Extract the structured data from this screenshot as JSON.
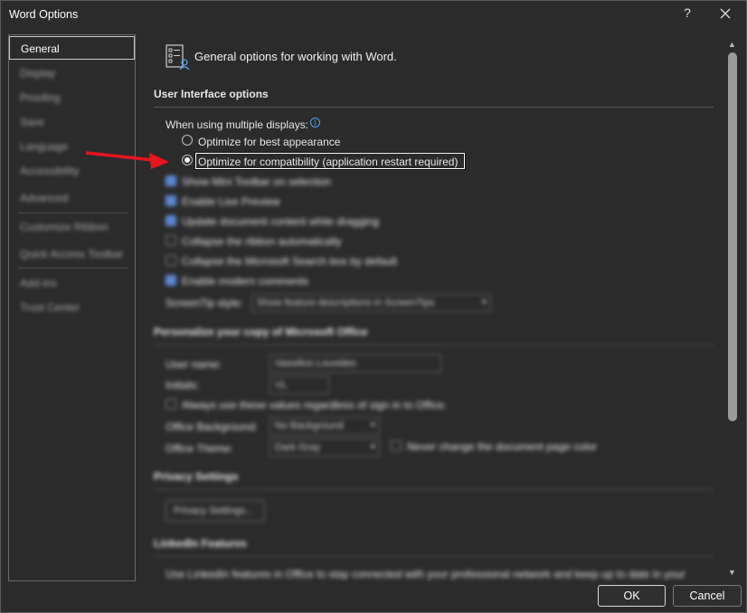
{
  "window": {
    "title": "Word Options",
    "help": "?"
  },
  "sidebar": {
    "items": [
      {
        "label": "General"
      },
      {
        "label": "Display"
      },
      {
        "label": "Proofing"
      },
      {
        "label": "Save"
      },
      {
        "label": "Language"
      },
      {
        "label": "Accessibility"
      },
      {
        "label": "Advanced"
      },
      {
        "label": "Customize Ribbon"
      },
      {
        "label": "Quick Access Toolbar"
      },
      {
        "label": "Add-ins"
      },
      {
        "label": "Trust Center"
      }
    ]
  },
  "main": {
    "header": "General options for working with Word.",
    "ui_section": {
      "title": "User Interface options",
      "multi_display_label": "When using multiple displays:",
      "radio_best": "Optimize for best appearance",
      "radio_compat": "Optimize for compatibility (application restart required)",
      "show_mini_toolbar": "Show Mini Toolbar on selection",
      "enable_live_preview": "Enable Live Preview",
      "update_content_dragging": "Update document content while dragging",
      "collapse_ribbon": "Collapse the ribbon automatically",
      "collapse_search": "Collapse the Microsoft Search box by default",
      "enable_modern_comments": "Enable modern comments",
      "screentip_label": "ScreenTip style:",
      "screentip_value": "Show feature descriptions in ScreenTips"
    },
    "personalize_section": {
      "title": "Personalize your copy of Microsoft Office",
      "username_label": "User name:",
      "username_value": "Vassilios Louvides",
      "initials_label": "Initials:",
      "initials_value": "VL",
      "always_use_label": "Always use these values regardless of sign in to Office.",
      "background_label": "Office Background:",
      "background_value": "No Background",
      "theme_label": "Office Theme:",
      "theme_value": "Dark Gray",
      "never_change_label": "Never change the document page color"
    },
    "privacy_section": {
      "title": "Privacy Settings",
      "button": "Privacy Settings..."
    },
    "linkedin_section": {
      "title": "LinkedIn Features",
      "text": "Use LinkedIn features in Office to stay connected with your professional network and keep up to date in your"
    }
  },
  "footer": {
    "ok": "OK",
    "cancel": "Cancel"
  },
  "colors": {
    "accent": "#4aa3ff",
    "arrow": "#e8141c",
    "checkbox": "#5b8bd6"
  }
}
